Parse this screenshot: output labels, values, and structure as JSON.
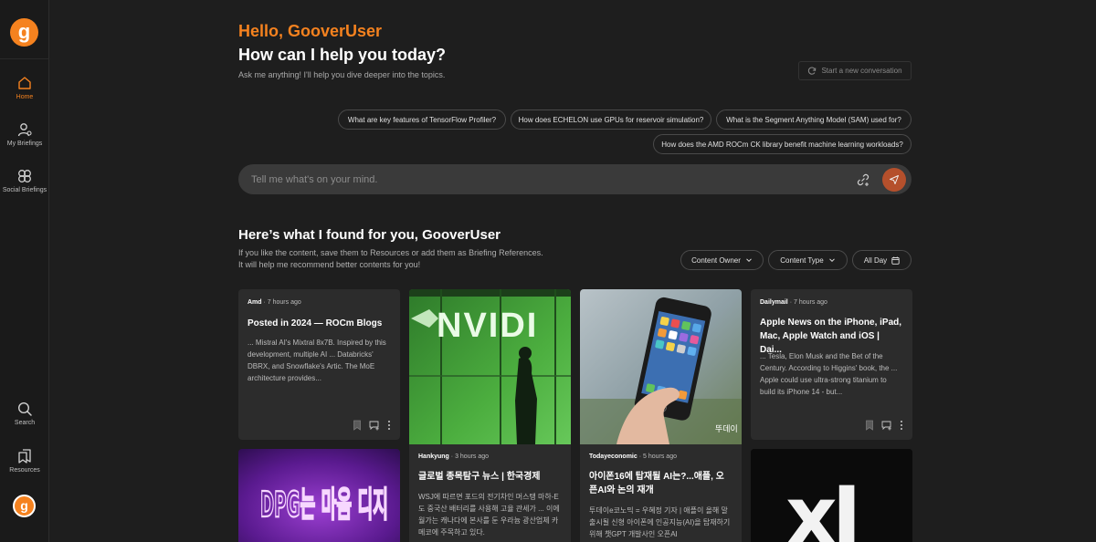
{
  "sidebar": {
    "logo": "g",
    "items": [
      {
        "label": "Home",
        "icon": "home-icon",
        "active": true
      },
      {
        "label": "My Briefings",
        "icon": "person-icon"
      },
      {
        "label": "Social Briefings",
        "icon": "group-icon"
      },
      {
        "label": "Search",
        "icon": "search-icon"
      },
      {
        "label": "Resources",
        "icon": "bookmarks-icon"
      }
    ],
    "avatar": "g"
  },
  "header": {
    "greeting": "Hello, GooverUser",
    "headline": "How can I help you today?",
    "subline": "Ask me anything! I'll help you dive deeper into the topics.",
    "new_conversation": "Start a new conversation"
  },
  "suggestions": [
    "What are key features of TensorFlow Profiler?",
    "How does ECHELON use GPUs for reservoir simulation?",
    "What is the Segment Anything Model (SAM) used for?",
    "How does the AMD ROCm CK library benefit machine learning workloads?"
  ],
  "prompt": {
    "placeholder": "Tell me what's on your mind."
  },
  "found": {
    "title": "Here’s what I found for you, GooverUser",
    "sub_line1": "If you like the content, save them to Resources or add them as Briefing References.",
    "sub_line2": "It will help me recommend better contents for you!",
    "filters": [
      "Content Owner",
      "Content Type",
      "All Day"
    ]
  },
  "cards": [
    {
      "source": "Amd",
      "time": "· 7 hours ago",
      "title": "Posted in 2024 — ROCm Blogs",
      "desc": "... Mistral AI's Mixtral 8x7B. Inspired by this development, multiple AI ... Databricks' DBRX, and Snowflake's Artic. The MoE architecture provides..."
    },
    {
      "image_text": "NVIDI"
    },
    {
      "image_text": "phone",
      "watermark": "뚜데이"
    },
    {
      "source": "Dailymail",
      "time": "· 7 hours ago",
      "title": "Apple News on the iPhone, iPad, Mac, Apple Watch and iOS | Dai...",
      "desc": "... Tesla, Elon Musk and the Bet of the Century. According to Higgins' book, the ... Apple could use ultra-strong titanium to build its iPhone 14 - but..."
    },
    {
      "image_text": "DPG는 마음 디지"
    },
    {
      "source": "Hankyung",
      "time": "· 3 hours ago",
      "title": "글로벌 종목탐구 뉴스 | 한국경제",
      "desc": "WSJ에 따르면 포드의 전기차인 머스탱 마하-E도 중국산 배터리를 사용해 고율 관세가 ... 이에 월가는 캐나다에 본사를 둔 우라늄 광산업체 카메코에 주목하고 있다."
    },
    {
      "source": "Todayeconomic",
      "time": "· 5 hours ago",
      "title": "아이폰16에 탑재될 AI는?...애플, 오픈AI와 논의 재개",
      "desc": "투데이e코노믹 = 우혜정 기자 | 애플이 올해 말 출시될 신형 아이폰에 인공지능(AI)을 탑재하기 위해 챗GPT 개발사인 오픈AI"
    },
    {
      "image_text": "xI"
    }
  ],
  "colors": {
    "accent": "#f5821f",
    "background": "#1e1e1e",
    "card": "#2c2c2c",
    "send": "#b5502c"
  }
}
